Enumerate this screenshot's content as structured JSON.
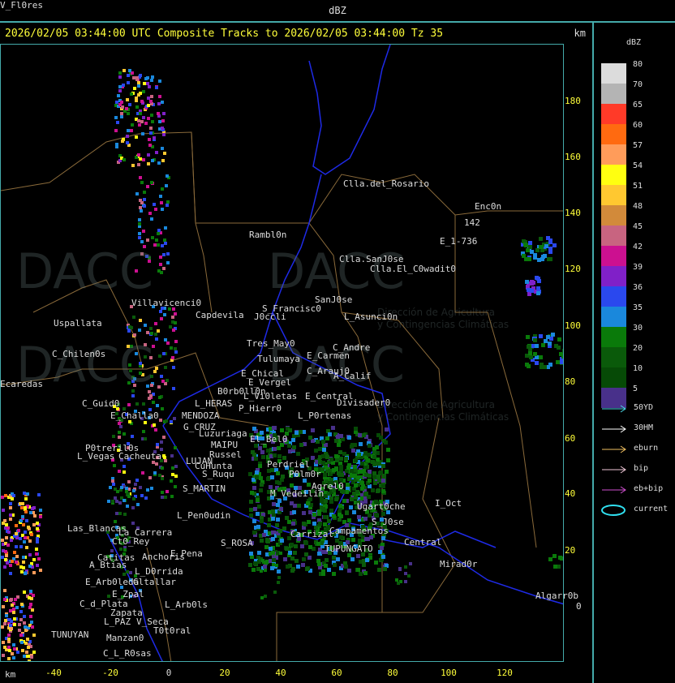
{
  "header": {
    "title": "dBZ"
  },
  "titlebar": {
    "text": "2026/02/05 03:44:00 UTC Composite Tracks to 2026/02/05 03:44:00 Tz 35",
    "unit": "km"
  },
  "axes": {
    "right_ticks": [
      "180",
      "160",
      "140",
      "120",
      "100",
      "80",
      "60",
      "40",
      "20",
      "0"
    ],
    "bottom_ticks": [
      "-40",
      "-20",
      "0",
      "20",
      "40",
      "60",
      "80",
      "100",
      "120"
    ],
    "bottom_unit": "km"
  },
  "legend": {
    "title": "dBZ",
    "items": [
      {
        "label": "80",
        "color": "#dcdcdc"
      },
      {
        "label": "70",
        "color": "#b4b4b4"
      },
      {
        "label": "65",
        "color": "#ff3a28"
      },
      {
        "label": "60",
        "color": "#ff6a10"
      },
      {
        "label": "57",
        "color": "#ff9c5a"
      },
      {
        "label": "54",
        "color": "#ffff10"
      },
      {
        "label": "51",
        "color": "#ffc830"
      },
      {
        "label": "48",
        "color": "#d28a3a"
      },
      {
        "label": "45",
        "color": "#c86480"
      },
      {
        "label": "42",
        "color": "#cc1090"
      },
      {
        "label": "39",
        "color": "#8020c8"
      },
      {
        "label": "36",
        "color": "#2a48ee"
      },
      {
        "label": "35",
        "color": "#1a88dc"
      },
      {
        "label": "30",
        "color": "#0a7a0a"
      },
      {
        "label": "20",
        "color": "#0a5a0a"
      },
      {
        "label": "10",
        "color": "#064a06"
      },
      {
        "label": "5",
        "color": "#48308a"
      }
    ],
    "tracks": [
      {
        "label": "50YD",
        "color": "#4ad8e8"
      },
      {
        "label": "30HM",
        "color": "#ffffff"
      },
      {
        "label": "eburn",
        "color": "#f0c060"
      },
      {
        "label": "bip",
        "color": "#f0c8d8"
      },
      {
        "label": "eb+bip",
        "color": "#d050d0"
      },
      {
        "label": "current",
        "color": "#30e0f0"
      }
    ]
  },
  "watermark": {
    "brand": "DACC",
    "line1": "Dirección de Agricultura",
    "line2": "y Contingencias Climáticas"
  },
  "places": [
    "Clla.del_Rosario",
    "Enc0n",
    "142",
    "E_1-736",
    "Rambl0n",
    "Clla.SanJ0se",
    "Clla.El_C0wadit0",
    "Villavicenci0",
    "SanJ0se",
    "S_Francisc0",
    "Capdevila",
    "L_Asunci0n",
    "Uspallata",
    "J0ccli",
    "Tres_May0",
    "Tulumaya",
    "C_Andre",
    "E_Carmen",
    "C_Chilen0s",
    "E_Chical",
    "C_Arauj0",
    "E_Vergel",
    "A_Calif",
    "Ecaredas",
    "B0rb0ll0n",
    "L_Vi0letas",
    "E_Central",
    "Divisader0",
    "L_HERAS",
    "P_Hierr0",
    "C_Guid0",
    "E_Challa0",
    "MENDOZA",
    "L_P0rtenas",
    "G_CRUZ",
    "Luzuriaga",
    "El_Bel0",
    "P0treril0s",
    "MAIPU",
    "Russel",
    "L_Vegas",
    "Cacheuta",
    "LUJAN",
    "CuHunta",
    "S_Ruqu",
    "Perdriel",
    "P0lm0r",
    "S_MARTIN",
    "Agrel0",
    "M_Vedeilin",
    "L_Pen0udin",
    "Ugart0che",
    "I_Oct",
    "Las_Blancas",
    "La_Carrera",
    "Ct0_Rey",
    "S_J0se",
    "S_ROSA",
    "Carrizal",
    "Campamentos",
    "Central",
    "Catitas",
    "E_Pena",
    "Anchoris",
    "A_Btias",
    "TUPUNGATO",
    "Mirad0r",
    "L_D0rrida",
    "E_Arb0leda",
    "Gltallar",
    "E_Zpal",
    "C_d_Plata",
    "L_Arb0ls",
    "Zapata",
    "Algarr0b",
    "L_PAZ",
    "V_Seca",
    "T0t0ral",
    "TUNUYAN",
    "Manzan0",
    "C_L_R0sas",
    "V_Fl0res"
  ]
}
